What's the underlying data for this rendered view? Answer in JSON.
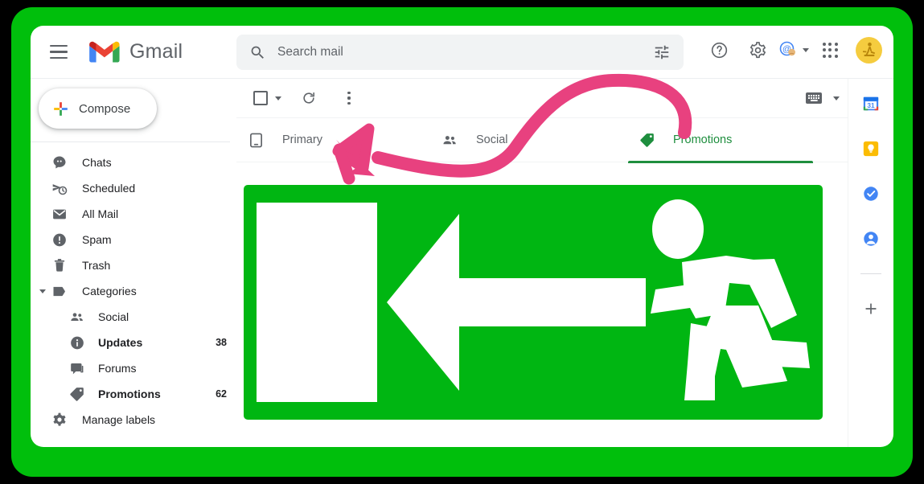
{
  "window": {
    "frame_color": "#000000",
    "bezel_color": "#00bf0c"
  },
  "header": {
    "menu_icon": "hamburger-icon",
    "logo_icon": "gmail-logo-icon",
    "app_title": "Gmail",
    "help_icon": "help-circle-icon",
    "settings_icon": "gear-icon",
    "mail_at_icon": "at-mention-icon",
    "apps_icon": "apps-grid-icon",
    "avatar_icon": "user-avatar"
  },
  "search": {
    "icon": "search-icon",
    "placeholder": "Search mail",
    "value": "",
    "filter_icon": "tune-filter-icon"
  },
  "compose": {
    "icon": "plus-icon",
    "label": "Compose"
  },
  "sidebar": {
    "items": [
      {
        "label": "Chats",
        "icon": "chat-bubble-icon",
        "count": "",
        "bold": false,
        "sub": false
      },
      {
        "label": "Scheduled",
        "icon": "scheduled-send-icon",
        "count": "",
        "bold": false,
        "sub": false
      },
      {
        "label": "All Mail",
        "icon": "mail-stack-icon",
        "count": "",
        "bold": false,
        "sub": false
      },
      {
        "label": "Spam",
        "icon": "spam-alert-icon",
        "count": "",
        "bold": false,
        "sub": false
      },
      {
        "label": "Trash",
        "icon": "trash-icon",
        "count": "",
        "bold": false,
        "sub": false
      },
      {
        "label": "Categories",
        "icon": "label-tag-icon",
        "count": "",
        "bold": false,
        "sub": false,
        "expander": true
      },
      {
        "label": "Social",
        "icon": "people-icon",
        "count": "",
        "bold": false,
        "sub": true
      },
      {
        "label": "Updates",
        "icon": "info-circle-icon",
        "count": "38",
        "bold": true,
        "sub": true
      },
      {
        "label": "Forums",
        "icon": "forum-icon",
        "count": "",
        "bold": false,
        "sub": true
      },
      {
        "label": "Promotions",
        "icon": "tag-icon",
        "count": "62",
        "bold": true,
        "sub": true
      },
      {
        "label": "Manage labels",
        "icon": "gear-icon",
        "count": "",
        "bold": false,
        "sub": false
      }
    ]
  },
  "toolbar": {
    "select_all_icon": "checkbox-icon",
    "select_caret_icon": "chevron-down-icon",
    "refresh_icon": "refresh-icon",
    "more_icon": "more-vertical-icon",
    "keyboard_icon": "keyboard-icon",
    "keyboard_caret_icon": "chevron-down-icon"
  },
  "tabs": [
    {
      "label": "Primary",
      "icon": "inbox-tab-icon",
      "active": false
    },
    {
      "label": "Social",
      "icon": "people-icon",
      "active": false
    },
    {
      "label": "Promotions",
      "icon": "tag-icon",
      "active": true
    }
  ],
  "content": {
    "image_name": "emergency-exit-sign",
    "sign_green": "#00b612",
    "sign_white": "#ffffff"
  },
  "rail": {
    "items": [
      {
        "icon": "google-calendar-icon"
      },
      {
        "icon": "google-keep-icon"
      },
      {
        "icon": "google-tasks-icon"
      },
      {
        "icon": "google-contacts-icon"
      }
    ],
    "add_icon": "plus-icon"
  },
  "annotation": {
    "arrow_color": "#e8417f",
    "arrow_name": "pink-curved-arrow-to-primary-tab"
  }
}
